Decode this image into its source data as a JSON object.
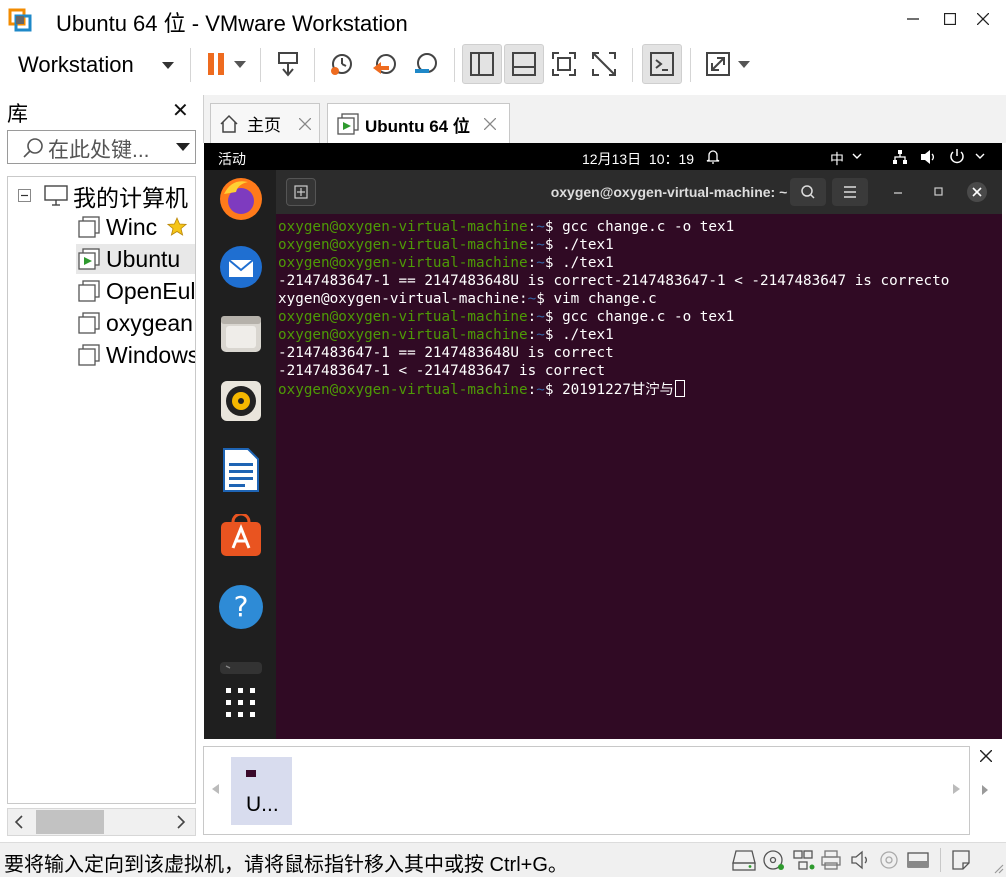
{
  "window": {
    "title": "Ubuntu 64 位 - VMware Workstation"
  },
  "toolbar": {
    "workstation_label": "Workstation"
  },
  "library": {
    "title": "库",
    "search_placeholder": "在此处键...",
    "root": "我的计算机",
    "vms": [
      "Winc",
      "Ubuntu",
      "OpenEul",
      "oxygean",
      "Windows"
    ]
  },
  "tabs": [
    {
      "label": "主页",
      "active": false
    },
    {
      "label": "Ubuntu 64 位",
      "active": true
    }
  ],
  "ubuntu": {
    "activities": "活动",
    "clock": "12月13日  10：19",
    "input_method": "中",
    "terminal_title": "oxygen@oxygen-virtual-machine: ~",
    "prompt_user": "oxygen@oxygen-virtual-machine",
    "prompt_path": "~",
    "lines": [
      {
        "type": "prompt",
        "cmd": "gcc change.c -o tex1"
      },
      {
        "type": "prompt",
        "cmd": "./tex1"
      },
      {
        "type": "prompt",
        "cmd": "./tex1"
      },
      {
        "type": "output",
        "text": "-2147483647-1 == 2147483648U is correct-2147483647-1 < -2147483647 is correcto"
      },
      {
        "type": "wrapped",
        "user": "xygen@oxygen-virtual-machine",
        "cmd": "vim change.c"
      },
      {
        "type": "prompt",
        "cmd": "gcc change.c -o tex1"
      },
      {
        "type": "prompt",
        "cmd": "./tex1"
      },
      {
        "type": "output",
        "text": "-2147483647-1 == 2147483648U is correct"
      },
      {
        "type": "output",
        "text": "-2147483647-1 < -2147483647 is correct"
      },
      {
        "type": "prompt",
        "cmd": "20191227甘泞与"
      }
    ]
  },
  "thumbnail": {
    "label": "U..."
  },
  "status": {
    "text": "要将输入定向到该虚拟机，请将鼠标指针移入其中或按 Ctrl+G。"
  }
}
